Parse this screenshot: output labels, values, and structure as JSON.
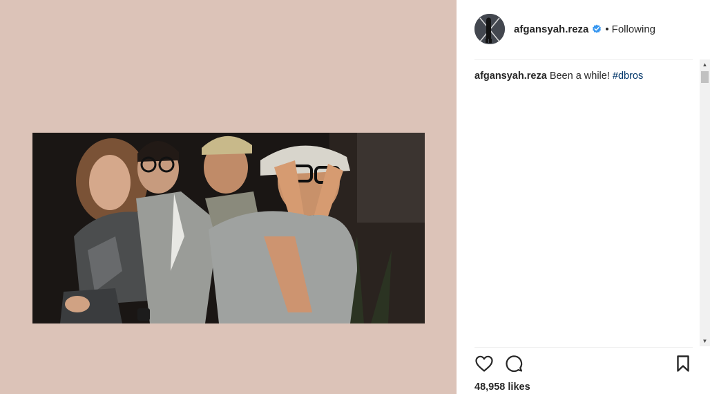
{
  "post": {
    "username": "afgansyah.reza",
    "verified": true,
    "separator": "•",
    "follow_state": "Following"
  },
  "caption": {
    "username": "afgansyah.reza",
    "text": "Been a while!",
    "hashtag": "#dbros"
  },
  "stats": {
    "likes_count": "48,958",
    "likes_label": "likes"
  },
  "colors": {
    "media_background": "#dcc3b8",
    "verified_badge": "#3897f0",
    "hashtag": "#003569",
    "text": "#262626"
  },
  "icons": {
    "like": "heart-icon",
    "comment": "comment-icon",
    "save": "bookmark-icon",
    "verified": "verified-badge-icon"
  }
}
